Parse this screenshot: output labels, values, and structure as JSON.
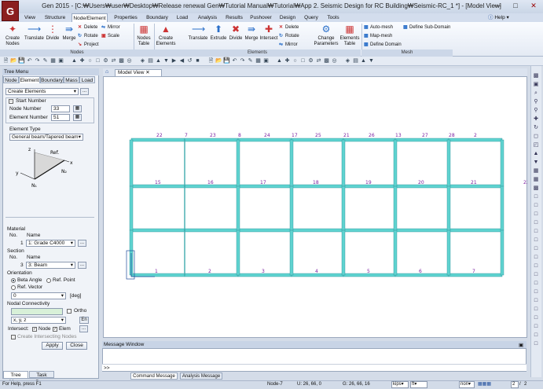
{
  "window": {
    "title": "Gen 2015 - [C:₩Users₩user₩Desktop₩Release renewal Gen₩Tutorial Manual₩Tutorial₩App 2. Seismic Design for RC Building₩Seismic-RC_1 *] - [Model View]",
    "logo_text": "G",
    "help_label": "Help"
  },
  "menu_tabs": [
    "View",
    "Structure",
    "Node/Element",
    "Properties",
    "Boundary",
    "Load",
    "Analysis",
    "Results",
    "Pushover",
    "Design",
    "Query",
    "Tools"
  ],
  "ribbon": {
    "nodes_group": "Nodes",
    "elements_group": "Elements",
    "mesh_group": "Mesh",
    "create_nodes": "Create Nodes",
    "translate": "Translate",
    "divide": "Divide",
    "merge": "Merge",
    "delete": "Delete",
    "rotate": "Rotate",
    "project": "Project",
    "mirror": "Mirror",
    "scale": "Scale",
    "nodes_table": "Nodes Table",
    "create_elements": "Create Elements",
    "extrude": "Extrude",
    "intersect": "Intersect",
    "change_parameters": "Change Parameters",
    "elements_table": "Elements Table",
    "auto_mesh": "Auto-mesh",
    "map_mesh": "Map-mesh",
    "define_domain": "Define Domain",
    "define_sub_domain": "Define Sub-Domain"
  },
  "tree_panel": {
    "title": "Tree Menu",
    "tabs": [
      "Node",
      "Element",
      "Boundary",
      "Mass",
      "Load"
    ],
    "mode": "Create Elements",
    "start_number_label": "Start Number",
    "node_number_label": "Node Number",
    "node_number": "33",
    "element_number_label": "Element Number",
    "element_number": "51",
    "element_type_label": "Element Type",
    "element_type": "General beam/Tapered beam",
    "diagram": {
      "ref": "Ref.",
      "x": "x",
      "y": "y",
      "z": "z",
      "n1": "N₁",
      "n2": "N₂"
    },
    "material_label": "Material",
    "no_label": "No.",
    "name_label": "Name",
    "material_no": "1",
    "material_name": "1: Grade C4000",
    "section_label": "Section",
    "section_no": "3",
    "section_name": "3: Beam",
    "orientation_label": "Orientation",
    "beta_angle": "Beta Angle",
    "ref_point": "Ref. Point",
    "ref_vector": "Ref. Vector",
    "angle_value": "0",
    "deg_unit": "[deg]",
    "nodal_connectivity": "Nodal Connectivity",
    "ortho": "Ortho",
    "plane": "x, y, z",
    "en_label": "En",
    "intersect_label": "Intersect:",
    "node_chk": "Node",
    "elem_chk": "Elem",
    "create_intersecting": "Create Intersecting Nodes",
    "apply": "Apply",
    "close": "Close",
    "bottom_tabs": [
      "Tree Menu",
      "Task Pane"
    ]
  },
  "model_view": {
    "tab": "Model View",
    "node_labels": [
      "22",
      "7",
      "23",
      "8",
      "24",
      "17",
      "25",
      "21",
      "26",
      "13",
      "27",
      "28",
      "2"
    ],
    "mid_labels": [
      "15",
      "16",
      "17",
      "18",
      "19",
      "20",
      "21",
      "22"
    ],
    "bottom_labels": [
      "1",
      "2",
      "3",
      "4",
      "5",
      "6",
      "7"
    ]
  },
  "message": {
    "title": "Message Window",
    "prompt": ">>",
    "tabs": [
      "Command Message",
      "Analysis Message"
    ]
  },
  "status": {
    "help": "For Help, press F1",
    "node": "Node-7",
    "u": "U: 26, 66, 0",
    "g": "G: 26, 66, 16",
    "unit_force": "kips",
    "unit_len": "ft",
    "view": "non",
    "page": "2",
    "page_total": "2"
  },
  "colors": {
    "accent": "#1f4e9c",
    "member": "#5fd3d0",
    "frame_line": "#2a8f96",
    "label": "#7a1fa0"
  }
}
